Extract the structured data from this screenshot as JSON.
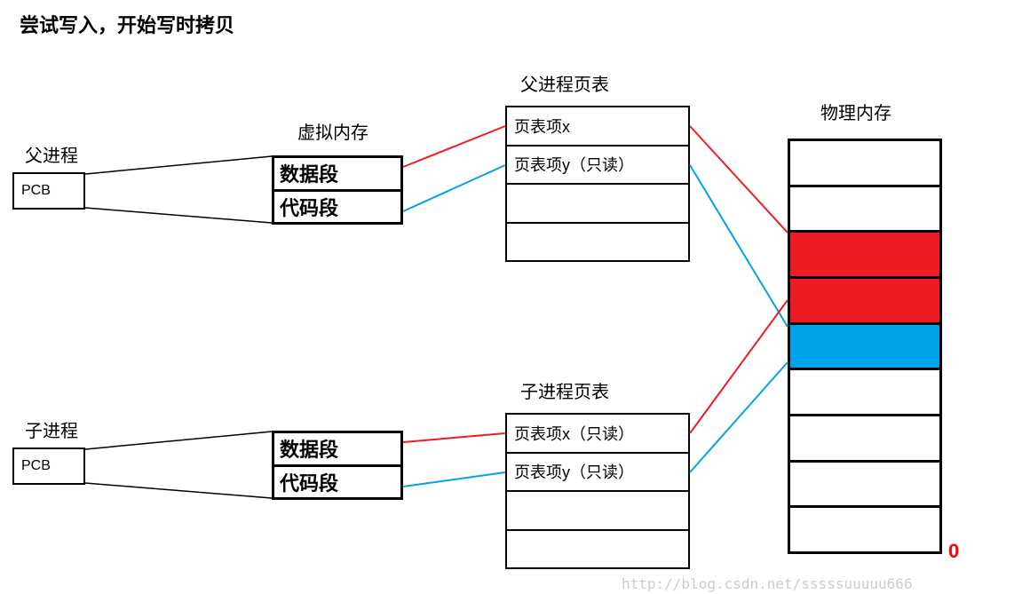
{
  "title": "尝试写入，开始写时拷贝",
  "parent": {
    "label": "父进程",
    "pcb": "PCB",
    "vm_title": "虚拟内存",
    "vm": [
      "数据段",
      "代码段"
    ],
    "pt_title": "父进程页表",
    "pt": [
      "页表项x",
      "页表项y（只读）",
      "",
      ""
    ]
  },
  "child": {
    "label": "子进程",
    "pcb": "PCB",
    "vm": [
      "数据段",
      "代码段"
    ],
    "pt_title": "子进程页表",
    "pt": [
      "页表项x（只读）",
      "页表项y（只读）",
      "",
      ""
    ]
  },
  "phys": {
    "title": "物理内存",
    "zero": "0"
  },
  "watermark": "http://blog.csdn.net/sssssuuuuu666",
  "colors": {
    "red": "#ed1c24",
    "blue": "#00a2e8",
    "black": "#000000"
  }
}
